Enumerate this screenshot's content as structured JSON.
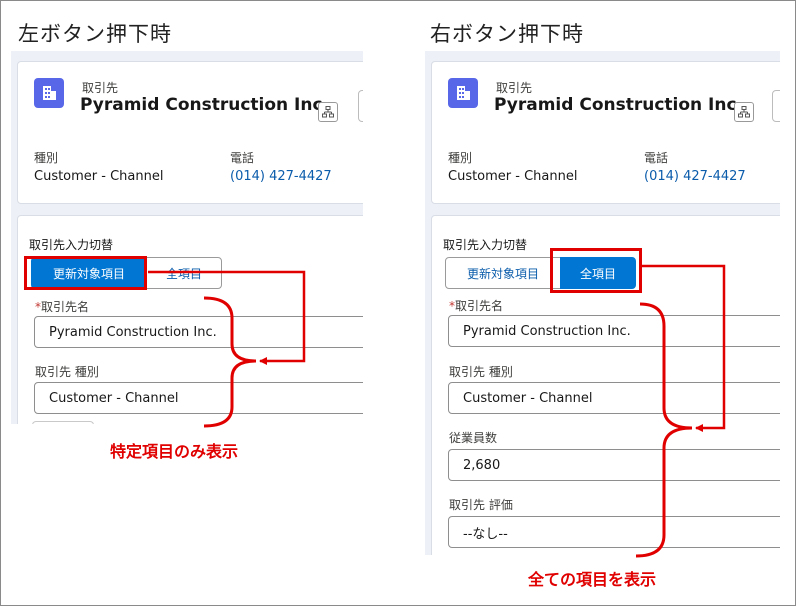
{
  "left": {
    "title": "左ボタン押下時",
    "object_label": "取引先",
    "account_name": "Pyramid Construction Inc.",
    "type_label": "種別",
    "type_value": "Customer - Channel",
    "phone_label": "電話",
    "phone_value": "(014) 427-4427",
    "switch_label": "取引先入力切替",
    "btn_update": "更新対象項目",
    "btn_all": "全項目",
    "fields": [
      {
        "label": "取引先名",
        "required": true,
        "value": "Pyramid Construction Inc."
      },
      {
        "label": "取引先 種別",
        "required": false,
        "value": "Customer - Channel"
      }
    ],
    "annotation": "特定項目のみ表示"
  },
  "right": {
    "title": "右ボタン押下時",
    "object_label": "取引先",
    "account_name": "Pyramid Construction Inc.",
    "type_label": "種別",
    "type_value": "Customer - Channel",
    "phone_label": "電話",
    "phone_value": "(014) 427-4427",
    "switch_label": "取引先入力切替",
    "btn_update": "更新対象項目",
    "btn_all": "全項目",
    "fields": [
      {
        "label": "取引先名",
        "required": true,
        "value": "Pyramid Construction Inc."
      },
      {
        "label": "取引先 種別",
        "required": false,
        "value": "Customer - Channel"
      },
      {
        "label": "従業員数",
        "required": false,
        "value": "2,680"
      },
      {
        "label": "取引先 評価",
        "required": false,
        "value": "--なし--"
      }
    ],
    "annotation": "全ての項目を表示"
  },
  "colors": {
    "highlight": "#e00000",
    "brand_button": "#0176d3",
    "object_icon": "#5867e8",
    "link": "#0b5cab"
  },
  "icons": [
    "building-icon",
    "hierarchy-icon"
  ],
  "required_mark": "*"
}
